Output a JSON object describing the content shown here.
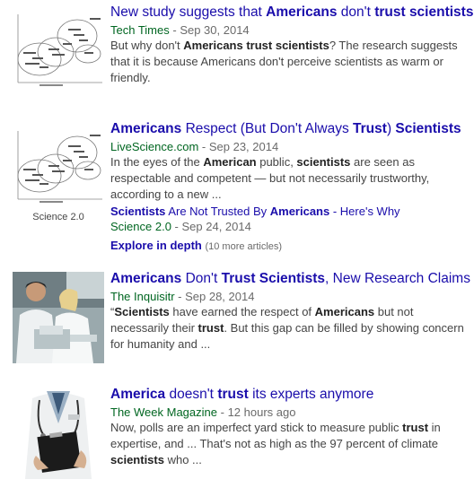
{
  "results": [
    {
      "title_parts": [
        {
          "t": "New study suggests that ",
          "b": false
        },
        {
          "t": "Americans",
          "b": true
        },
        {
          "t": " don't ",
          "b": false
        },
        {
          "t": "trust scientists",
          "b": true
        }
      ],
      "source": "Tech Times",
      "date": "Sep 30, 2014",
      "snippet_parts": [
        {
          "t": "But why don't ",
          "b": false
        },
        {
          "t": "Americans trust scientists",
          "b": true
        },
        {
          "t": "? The research suggests that it is because Americans don't perceive scientists as warm or friendly.",
          "b": false
        }
      ],
      "thumb_icon": "chart-thumbnail-icon"
    },
    {
      "title_parts": [
        {
          "t": "Americans",
          "b": true
        },
        {
          "t": " Respect (But Don't Always ",
          "b": false
        },
        {
          "t": "Trust",
          "b": true
        },
        {
          "t": ") ",
          "b": false
        },
        {
          "t": "Scientists",
          "b": true
        }
      ],
      "source": "LiveScience.com",
      "date": "Sep 23, 2014",
      "snippet_parts": [
        {
          "t": "In the eyes of the ",
          "b": false
        },
        {
          "t": "American",
          "b": true
        },
        {
          "t": " public, ",
          "b": false
        },
        {
          "t": "scientists",
          "b": true
        },
        {
          "t": " are seen as respectable and competent — but not necessarily trustworthy, according to a new ...",
          "b": false
        }
      ],
      "thumb_caption": "Science 2.0",
      "thumb_icon": "chart-thumbnail-icon",
      "sub_article": {
        "title_parts": [
          {
            "t": "Scientists",
            "b": true
          },
          {
            "t": " Are Not Trusted By ",
            "b": false
          },
          {
            "t": "Americans",
            "b": true
          },
          {
            "t": " - Here's Why",
            "b": false
          }
        ],
        "source": "Science 2.0",
        "date": "Sep 24, 2014"
      },
      "explore": {
        "label": "Explore in depth",
        "count": "(10 more articles)"
      }
    },
    {
      "title_parts": [
        {
          "t": "Americans",
          "b": true
        },
        {
          "t": " Don't ",
          "b": false
        },
        {
          "t": "Trust Scientists",
          "b": true
        },
        {
          "t": ", New Research Claims",
          "b": false
        }
      ],
      "source": "The Inquisitr",
      "date": "Sep 28, 2014",
      "snippet_parts": [
        {
          "t": "“",
          "b": false
        },
        {
          "t": "Scientists",
          "b": true
        },
        {
          "t": " have earned the respect of ",
          "b": false
        },
        {
          "t": "Americans",
          "b": true
        },
        {
          "t": " but not necessarily their ",
          "b": false
        },
        {
          "t": "trust",
          "b": true
        },
        {
          "t": ". But this gap can be filled by showing concern for humanity and ...",
          "b": false
        }
      ],
      "thumb_icon": "lab-photo-icon"
    },
    {
      "title_parts": [
        {
          "t": "America",
          "b": true
        },
        {
          "t": " doesn't ",
          "b": false
        },
        {
          "t": "trust",
          "b": true
        },
        {
          "t": " its experts anymore",
          "b": false
        }
      ],
      "source": "The Week Magazine",
      "date": "12 hours ago",
      "snippet_parts": [
        {
          "t": "Now, polls are an imperfect yard stick to measure public ",
          "b": false
        },
        {
          "t": "trust",
          "b": true
        },
        {
          "t": " in expertise, and ... That's not as high as the 97 percent of climate ",
          "b": false
        },
        {
          "t": "scientists",
          "b": true
        },
        {
          "t": " who ...",
          "b": false
        }
      ],
      "thumb_icon": "doctor-photo-icon"
    }
  ],
  "separator": " - "
}
